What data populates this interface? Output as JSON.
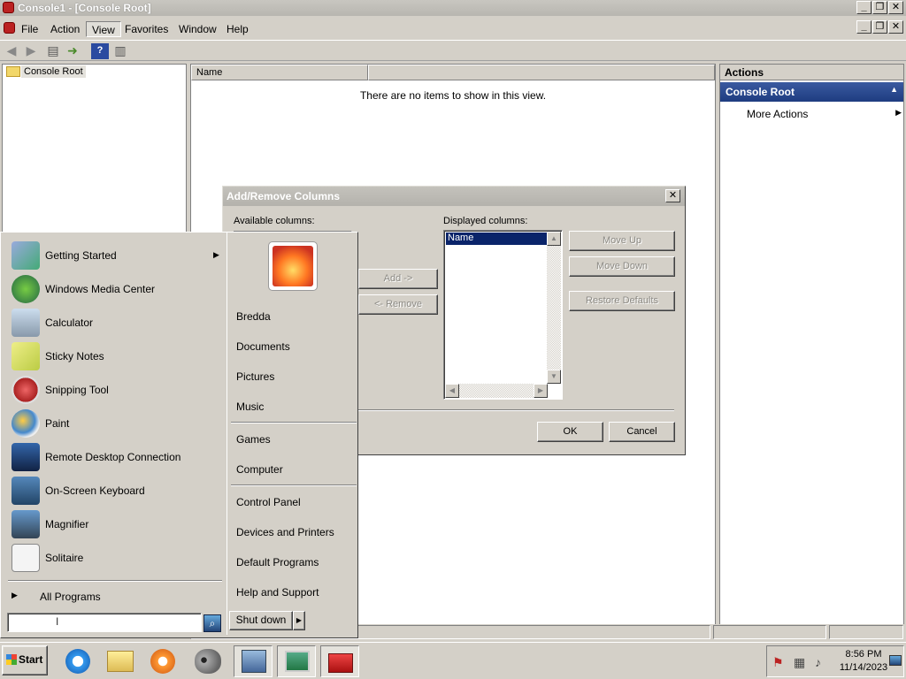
{
  "window": {
    "title": "Console1 - [Console Root]"
  },
  "menu": [
    "File",
    "Action",
    "View",
    "Favorites",
    "Window",
    "Help"
  ],
  "tree": {
    "root": "Console Root"
  },
  "list": {
    "column": "Name",
    "empty_message": "There are no items to show in this view."
  },
  "actions": {
    "header": "Actions",
    "section": "Console Root",
    "items": [
      "More Actions"
    ]
  },
  "dialog": {
    "title": "Add/Remove Columns",
    "available_label": "Available columns:",
    "displayed_label": "Displayed columns:",
    "displayed_items": [
      "Name"
    ],
    "add_button": "Add ->",
    "remove_button": "<- Remove",
    "move_up": "Move Up",
    "move_down": "Move Down",
    "restore_defaults": "Restore Defaults",
    "ok": "OK",
    "cancel": "Cancel"
  },
  "start_menu": {
    "programs": [
      "Getting Started",
      "Windows Media Center",
      "Calculator",
      "Sticky Notes",
      "Snipping Tool",
      "Paint",
      "Remote Desktop Connection",
      "On-Screen Keyboard",
      "Magnifier",
      "Solitaire"
    ],
    "all_programs": "All Programs",
    "search_placeholder": "",
    "right_links_1": [
      "Bredda",
      "Documents",
      "Pictures",
      "Music"
    ],
    "right_links_2": [
      "Games",
      "Computer"
    ],
    "right_links_3": [
      "Control Panel",
      "Devices and Printers",
      "Default Programs",
      "Help and Support"
    ],
    "shutdown": "Shut down"
  },
  "taskbar": {
    "start_label": "Start",
    "time": "8:56 PM",
    "date": "11/14/2023"
  },
  "colors": {
    "selection": "#0a246a",
    "actions_header": "#2a4a8a"
  }
}
